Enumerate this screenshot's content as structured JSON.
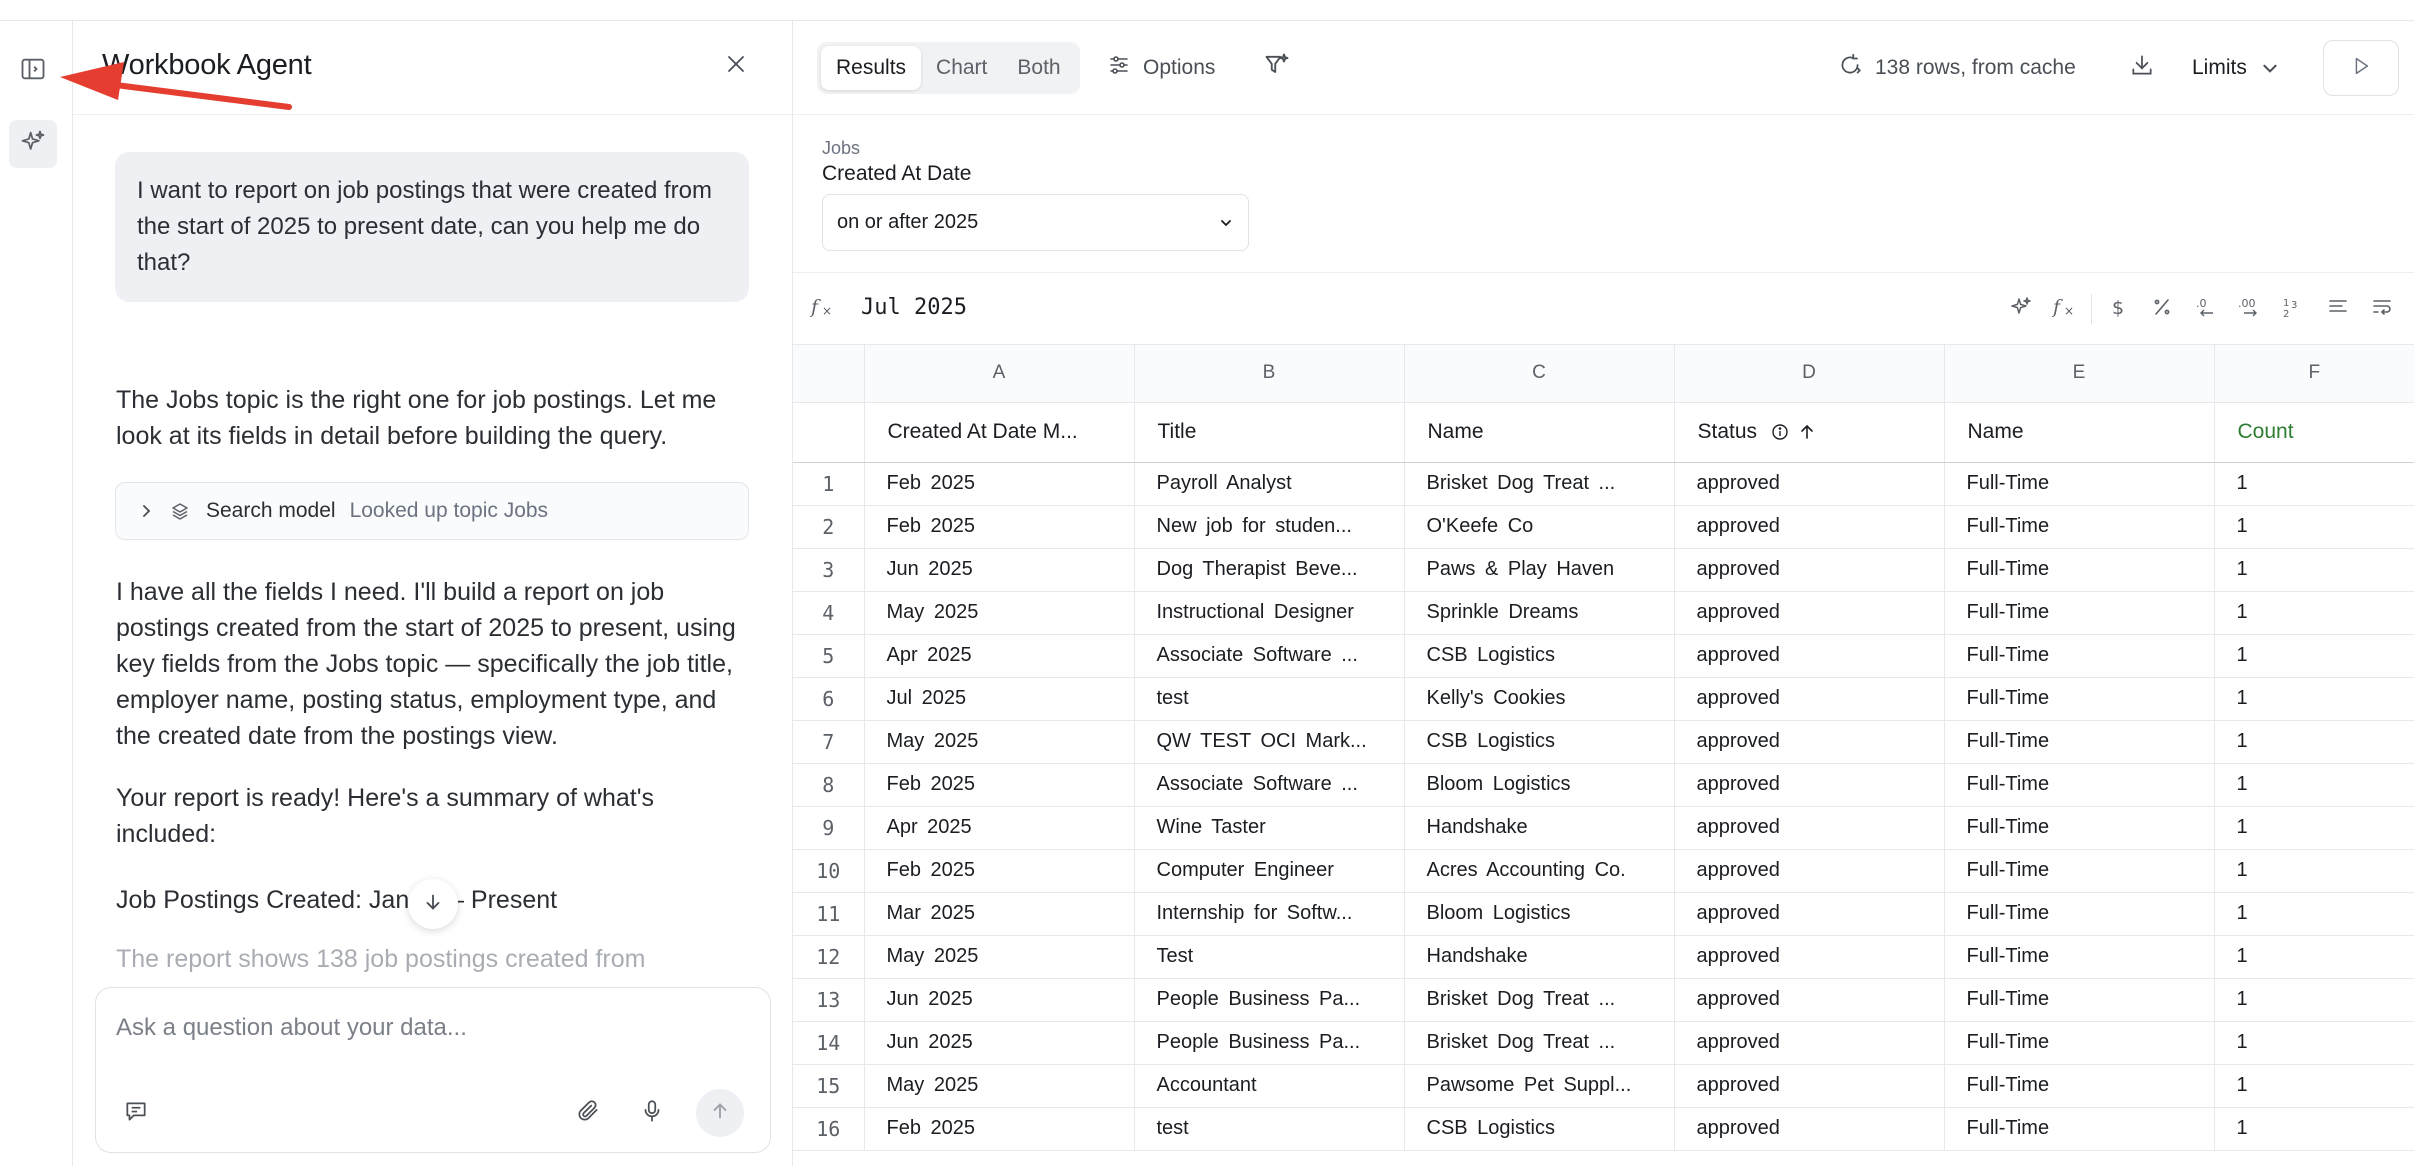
{
  "agent": {
    "title": "Workbook Agent",
    "user_message": "I want to report on job postings that were created from the start of 2025 to present date, can you help me do that?",
    "reply_1": "The Jobs topic is the right one for job postings. Let me look at its fields in detail before building the query.",
    "tool_call": {
      "name": "Search model",
      "description": "Looked up topic Jobs"
    },
    "reply_2": "I have all the fields I need. I'll build a report on job postings created from the start of 2025 to present, using key fields from the Jobs topic — specifically the job title, employer name, posting status, employment type, and the created date from the postings view.",
    "reply_3": "Your report is ready! Here's a summary of what's included:",
    "reply_4": "Job Postings Created: Jan",
    "reply_4_tail": "5 – Present",
    "reply_5_faded": "The report shows 138 job postings created from",
    "composer_placeholder": "Ask a question about your data..."
  },
  "toolbar": {
    "views": [
      "Results",
      "Chart",
      "Both"
    ],
    "active_view": "Results",
    "options_label": "Options",
    "cache_status": "138 rows, from cache",
    "limits_label": "Limits"
  },
  "filter": {
    "group": "Jobs",
    "label": "Created At Date",
    "value": "on or after 2025"
  },
  "formula_bar": {
    "value": "Jul 2025"
  },
  "grid": {
    "column_letters": [
      "A",
      "B",
      "C",
      "D",
      "E",
      "F"
    ],
    "headers": [
      "Created At Date M...",
      "Title",
      "Name",
      "Status",
      "Name",
      "Count"
    ],
    "rows": [
      [
        "1",
        "Feb 2025",
        "Payroll Analyst",
        "Brisket Dog Treat ...",
        "approved",
        "Full-Time",
        "1"
      ],
      [
        "2",
        "Feb 2025",
        "New job for studen...",
        "O'Keefe Co",
        "approved",
        "Full-Time",
        "1"
      ],
      [
        "3",
        "Jun 2025",
        "Dog Therapist Beve...",
        "Paws & Play Haven",
        "approved",
        "Full-Time",
        "1"
      ],
      [
        "4",
        "May 2025",
        "Instructional Designer",
        "Sprinkle Dreams",
        "approved",
        "Full-Time",
        "1"
      ],
      [
        "5",
        "Apr 2025",
        "Associate Software ...",
        "CSB Logistics",
        "approved",
        "Full-Time",
        "1"
      ],
      [
        "6",
        "Jul 2025",
        "test",
        "Kelly's Cookies",
        "approved",
        "Full-Time",
        "1"
      ],
      [
        "7",
        "May 2025",
        "QW TEST OCI Mark...",
        "CSB Logistics",
        "approved",
        "Full-Time",
        "1"
      ],
      [
        "8",
        "Feb 2025",
        "Associate Software ...",
        "Bloom Logistics",
        "approved",
        "Full-Time",
        "1"
      ],
      [
        "9",
        "Apr 2025",
        "Wine Taster",
        "Handshake",
        "approved",
        "Full-Time",
        "1"
      ],
      [
        "10",
        "Feb 2025",
        "Computer Engineer",
        "Acres Accounting Co.",
        "approved",
        "Full-Time",
        "1"
      ],
      [
        "11",
        "Mar 2025",
        "Internship for Softw...",
        "Bloom Logistics",
        "approved",
        "Full-Time",
        "1"
      ],
      [
        "12",
        "May 2025",
        "Test",
        "Handshake",
        "approved",
        "Full-Time",
        "1"
      ],
      [
        "13",
        "Jun 2025",
        "People Business Pa...",
        "Brisket Dog Treat ...",
        "approved",
        "Full-Time",
        "1"
      ],
      [
        "14",
        "Jun 2025",
        "People Business Pa...",
        "Brisket Dog Treat ...",
        "approved",
        "Full-Time",
        "1"
      ],
      [
        "15",
        "May 2025",
        "Accountant",
        "Pawsome Pet Suppl...",
        "approved",
        "Full-Time",
        "1"
      ],
      [
        "16",
        "Feb 2025",
        "test",
        "CSB Logistics",
        "approved",
        "Full-Time",
        "1"
      ]
    ]
  },
  "colors": {
    "count_header": "#2e7d32",
    "annotation_arrow": "#e53d2f"
  }
}
